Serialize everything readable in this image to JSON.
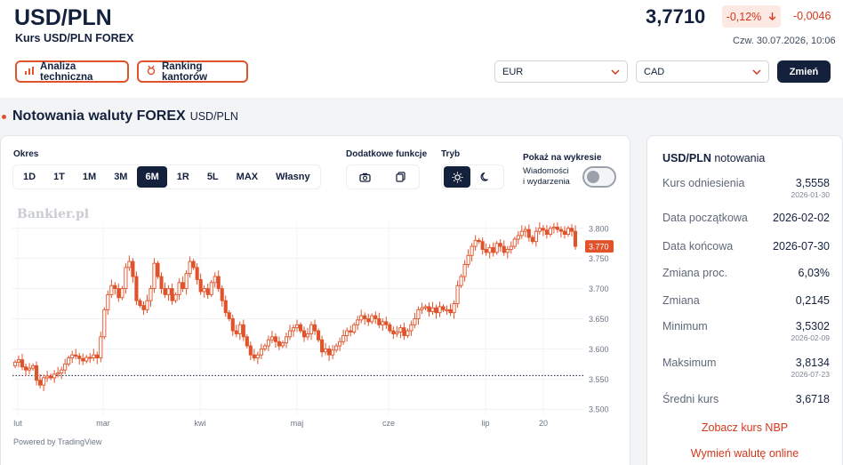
{
  "header": {
    "title": "USD/PLN",
    "subtitle": "Kurs USD/PLN FOREX",
    "price": "3,7710",
    "change_pct": "-0,12%",
    "change_abs": "-0,0046",
    "datetime": "Czw. 30.07.2026, 10:06",
    "btn_analysis": "Analiza techniczna",
    "btn_ranking": "Ranking kantorów",
    "select_from": "EUR",
    "select_to": "CAD",
    "btn_change": "Zmień"
  },
  "section": {
    "title": "Notowania waluty FOREX",
    "subtitle": "USD/PLN"
  },
  "controls": {
    "period_label": "Okres",
    "periods": [
      "1D",
      "1T",
      "1M",
      "3M",
      "6M",
      "1R",
      "5L",
      "MAX",
      "Własny"
    ],
    "active_period": "6M",
    "extra_label": "Dodatkowe funkcje",
    "mode_label": "Tryb",
    "show_label": "Pokaż na wykresie",
    "news_line1": "Wiadomości",
    "news_line2": "i wydarzenia"
  },
  "chart": {
    "watermark": "Bankier.pl",
    "powered_by": "Powered by TradingView",
    "last_price_label": "3.770"
  },
  "chart_data": {
    "type": "candlestick",
    "x_tick_labels": [
      "lut",
      "mar",
      "kwi",
      "maj",
      "cze",
      "lip",
      "20"
    ],
    "y_tick_labels": [
      "3.800",
      "3.750",
      "3.700",
      "3.650",
      "3.600",
      "3.550",
      "3.500"
    ],
    "ylim": [
      3.49,
      3.81
    ],
    "reference_line": 3.5558,
    "last_value": 3.77,
    "up_color": "#e0532b",
    "down_color": "#e0532b",
    "series_close": [
      3.578,
      3.582,
      3.57,
      3.565,
      3.568,
      3.572,
      3.548,
      3.54,
      3.552,
      3.555,
      3.552,
      3.558,
      3.56,
      3.565,
      3.575,
      3.585,
      3.59,
      3.588,
      3.584,
      3.58,
      3.586,
      3.585,
      3.59,
      3.585,
      3.62,
      3.665,
      3.69,
      3.705,
      3.7,
      3.685,
      3.7,
      3.735,
      3.745,
      3.72,
      3.68,
      3.672,
      3.665,
      3.68,
      3.7,
      3.742,
      3.72,
      3.7,
      3.69,
      3.7,
      3.68,
      3.69,
      3.71,
      3.7,
      3.725,
      3.745,
      3.735,
      3.715,
      3.695,
      3.7,
      3.69,
      3.71,
      3.72,
      3.7,
      3.68,
      3.66,
      3.65,
      3.63,
      3.625,
      3.64,
      3.62,
      3.605,
      3.59,
      3.585,
      3.59,
      3.6,
      3.605,
      3.615,
      3.62,
      3.612,
      3.605,
      3.61,
      3.62,
      3.63,
      3.635,
      3.64,
      3.63,
      3.62,
      3.625,
      3.64,
      3.63,
      3.615,
      3.595,
      3.6,
      3.59,
      3.598,
      3.605,
      3.612,
      3.622,
      3.63,
      3.628,
      3.64,
      3.648,
      3.655,
      3.65,
      3.645,
      3.655,
      3.65,
      3.64,
      3.645,
      3.64,
      3.63,
      3.625,
      3.628,
      3.635,
      3.622,
      3.63,
      3.64,
      3.65,
      3.665,
      3.668,
      3.67,
      3.662,
      3.668,
      3.66,
      3.67,
      3.665,
      3.665,
      3.66,
      3.675,
      3.705,
      3.72,
      3.74,
      3.755,
      3.77,
      3.78,
      3.778,
      3.765,
      3.76,
      3.768,
      3.76,
      3.775,
      3.77,
      3.76,
      3.765,
      3.77,
      3.782,
      3.788,
      3.795,
      3.798,
      3.785,
      3.778,
      3.795,
      3.8,
      3.797,
      3.79,
      3.8,
      3.802,
      3.798,
      3.795,
      3.79,
      3.8,
      3.795,
      3.77
    ]
  },
  "sidebar": {
    "title": "USD/PLN",
    "title_suffix": "notowania",
    "rows": [
      {
        "label": "Kurs odniesienia",
        "value": "3,5558",
        "date": "2026-01-30"
      },
      {
        "label": "Data początkowa",
        "value": "2026-02-02",
        "date": ""
      },
      {
        "label": "Data końcowa",
        "value": "2026-07-30",
        "date": ""
      },
      {
        "label": "Zmiana proc.",
        "value": "6,03%",
        "date": ""
      },
      {
        "label": "Zmiana",
        "value": "0,2145",
        "date": ""
      },
      {
        "label": "Minimum",
        "value": "3,5302",
        "date": "2026-02-09"
      },
      {
        "label": "Maksimum",
        "value": "3,8134",
        "date": "2026-07-23"
      },
      {
        "label": "Średni kurs",
        "value": "3,6718",
        "date": ""
      }
    ],
    "link_nbp": "Zobacz kurs NBP",
    "link_exchange": "Wymień walutę online"
  }
}
